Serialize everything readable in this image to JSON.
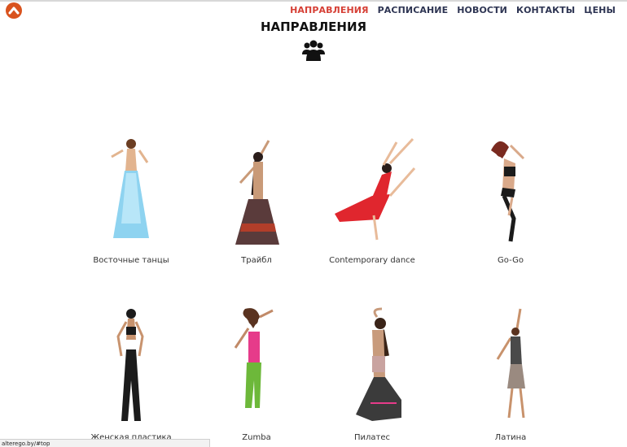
{
  "header": {
    "logo": "logo-icon",
    "nav": [
      {
        "label": "НАПРАВЛЕНИЯ",
        "active": true
      },
      {
        "label": "РАСПИСАНИЕ",
        "active": false
      },
      {
        "label": "НОВОСТИ",
        "active": false
      },
      {
        "label": "КОНТАКТЫ",
        "active": false
      },
      {
        "label": "ЦЕНЫ",
        "active": false
      }
    ]
  },
  "section": {
    "title": "НАПРАВЛЕНИЯ",
    "icon": "users-icon"
  },
  "directions": [
    {
      "label": "Восточные танцы",
      "color": "#8ed3f0"
    },
    {
      "label": "Трайбл",
      "color": "#5a3b3b"
    },
    {
      "label": "Contemporary dance",
      "color": "#e0262e"
    },
    {
      "label": "Go-Go",
      "color": "#1b1b1b"
    },
    {
      "label": "Женская пластика",
      "color": "#1b1b1b"
    },
    {
      "label": "Zumba",
      "color": "#e63b8a"
    },
    {
      "label": "Пилатес",
      "color": "#c9a3a0"
    },
    {
      "label": "Латина",
      "color": "#4a4a4a"
    }
  ],
  "colors": {
    "accent": "#d64036",
    "nav_text": "#2e3553",
    "logo": "#d9531e"
  },
  "statusbar": {
    "url": "alterego.by/#top"
  }
}
